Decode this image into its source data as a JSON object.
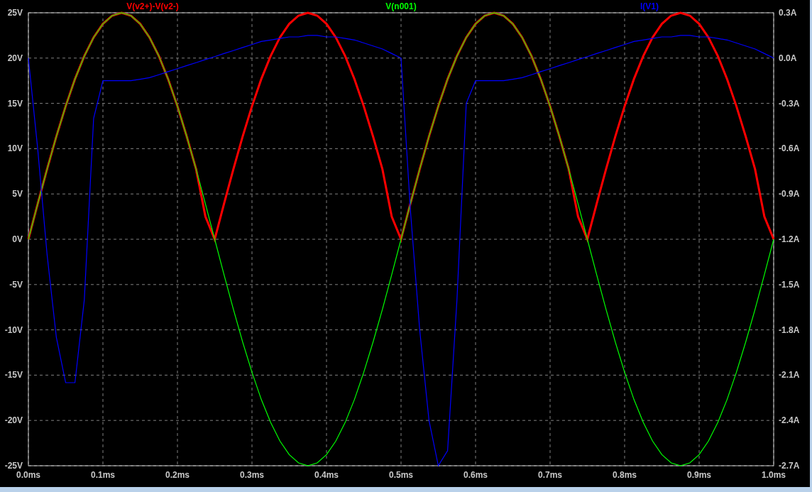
{
  "plot": {
    "chart_data": {
      "type": "line",
      "x": [
        0,
        0.0125,
        0.025,
        0.0375,
        0.05,
        0.0625,
        0.075,
        0.0875,
        0.1,
        0.1125,
        0.125,
        0.1375,
        0.15,
        0.1625,
        0.175,
        0.1875,
        0.2,
        0.2125,
        0.225,
        0.2375,
        0.25,
        0.2625,
        0.275,
        0.2875,
        0.3,
        0.3125,
        0.325,
        0.3375,
        0.35,
        0.3625,
        0.375,
        0.3875,
        0.4,
        0.4125,
        0.425,
        0.4375,
        0.45,
        0.4625,
        0.475,
        0.4875,
        0.5,
        0.5125,
        0.525,
        0.5375,
        0.55,
        0.5625,
        0.575,
        0.5875,
        0.6,
        0.6125,
        0.625,
        0.6375,
        0.65,
        0.6625,
        0.675,
        0.6875,
        0.7,
        0.7125,
        0.725,
        0.7375,
        0.75,
        0.7625,
        0.775,
        0.7875,
        0.8,
        0.8125,
        0.825,
        0.8375,
        0.85,
        0.8625,
        0.875,
        0.8875,
        0.9,
        0.9125,
        0.925,
        0.9375,
        0.95,
        0.9625,
        0.975,
        0.9875,
        1
      ],
      "series": [
        {
          "name": "V(v2+)-V(v2-)",
          "color": "#ff0000",
          "values": [
            0,
            3.91,
            7.73,
            11.35,
            14.69,
            17.68,
            20.23,
            22.28,
            23.78,
            24.69,
            25,
            24.69,
            23.78,
            22.28,
            20.23,
            17.68,
            14.69,
            11.35,
            7.73,
            2.5,
            0,
            3.91,
            7.73,
            11.35,
            14.69,
            17.68,
            20.23,
            22.28,
            23.78,
            24.69,
            25,
            24.69,
            23.78,
            22.28,
            20.23,
            17.68,
            14.69,
            11.35,
            7.73,
            2.5,
            0,
            3.91,
            7.73,
            11.35,
            14.69,
            17.68,
            20.23,
            22.28,
            23.78,
            24.69,
            25,
            24.69,
            23.78,
            22.28,
            20.23,
            17.68,
            14.69,
            11.35,
            7.73,
            2.5,
            0,
            3.91,
            7.73,
            11.35,
            14.69,
            17.68,
            20.23,
            22.28,
            23.78,
            24.69,
            25,
            24.69,
            23.78,
            22.28,
            20.23,
            17.68,
            14.69,
            11.35,
            7.73,
            2.5,
            0
          ]
        },
        {
          "name": "V(n001)",
          "color": "#00ff00",
          "values": [
            0,
            3.91,
            7.73,
            11.35,
            14.69,
            17.68,
            20.23,
            22.28,
            23.78,
            24.69,
            25,
            24.69,
            23.78,
            22.28,
            20.23,
            17.68,
            14.69,
            11.35,
            7.73,
            3.91,
            0,
            -3.91,
            -7.73,
            -11.35,
            -14.69,
            -17.68,
            -20.23,
            -22.28,
            -23.78,
            -24.69,
            -25,
            -24.69,
            -23.78,
            -22.28,
            -20.23,
            -17.68,
            -14.69,
            -11.35,
            -7.73,
            -3.91,
            0,
            3.91,
            7.73,
            11.35,
            14.69,
            17.68,
            20.23,
            22.28,
            23.78,
            24.69,
            25,
            24.69,
            23.78,
            22.28,
            20.23,
            17.68,
            14.69,
            11.35,
            7.73,
            3.91,
            0,
            -3.91,
            -7.73,
            -11.35,
            -14.69,
            -17.68,
            -20.23,
            -22.28,
            -23.78,
            -24.69,
            -25,
            -24.69,
            -23.78,
            -22.28,
            -20.23,
            -17.68,
            -14.69,
            -11.35,
            -7.73,
            -3.91,
            0
          ]
        },
        {
          "name": "I(V1)",
          "color": "#0000ff",
          "axis": "y2",
          "values": [
            0,
            -0.6,
            -1.3,
            -1.85,
            -2.15,
            -2.15,
            -1.6,
            -0.4,
            -0.15,
            -0.15,
            -0.15,
            -0.15,
            -0.14,
            -0.13,
            -0.11,
            -0.09,
            -0.07,
            -0.05,
            -0.03,
            -0.01,
            0.01,
            0.03,
            0.05,
            0.07,
            0.09,
            0.11,
            0.12,
            0.13,
            0.14,
            0.14,
            0.15,
            0.15,
            0.14,
            0.14,
            0.13,
            0.12,
            0.1,
            0.08,
            0.06,
            0.03,
            0,
            -1,
            -1.8,
            -2.4,
            -2.7,
            -2.6,
            -1.6,
            -0.3,
            -0.15,
            -0.15,
            -0.15,
            -0.15,
            -0.14,
            -0.13,
            -0.11,
            -0.09,
            -0.07,
            -0.05,
            -0.03,
            -0.01,
            0.01,
            0.03,
            0.05,
            0.07,
            0.09,
            0.11,
            0.12,
            0.13,
            0.14,
            0.14,
            0.15,
            0.15,
            0.14,
            0.14,
            0.13,
            0.12,
            0.1,
            0.08,
            0.06,
            0.03,
            0
          ]
        }
      ],
      "grid": true,
      "xlim": [
        0,
        1
      ],
      "ylim": [
        -25,
        25
      ],
      "y2lim": [
        -2.7,
        0.3
      ],
      "xticks": [
        {
          "value": 0,
          "label": "0.0ms"
        },
        {
          "value": 0.1,
          "label": "0.1ms"
        },
        {
          "value": 0.2,
          "label": "0.2ms"
        },
        {
          "value": 0.3,
          "label": "0.3ms"
        },
        {
          "value": 0.4,
          "label": "0.4ms"
        },
        {
          "value": 0.5,
          "label": "0.5ms"
        },
        {
          "value": 0.6,
          "label": "0.6ms"
        },
        {
          "value": 0.7,
          "label": "0.7ms"
        },
        {
          "value": 0.8,
          "label": "0.8ms"
        },
        {
          "value": 0.9,
          "label": "0.9ms"
        },
        {
          "value": 1,
          "label": "1.0ms"
        }
      ],
      "yticks": [
        {
          "value": 25,
          "label": "25V"
        },
        {
          "value": 20,
          "label": "20V"
        },
        {
          "value": 15,
          "label": "15V"
        },
        {
          "value": 10,
          "label": "10V"
        },
        {
          "value": 5,
          "label": "5V"
        },
        {
          "value": 0,
          "label": "0V"
        },
        {
          "value": -5,
          "label": "-5V"
        },
        {
          "value": -10,
          "label": "-10V"
        },
        {
          "value": -15,
          "label": "-15V"
        },
        {
          "value": -20,
          "label": "-20V"
        },
        {
          "value": -25,
          "label": "-25V"
        }
      ],
      "y2ticks": [
        {
          "value": 0.3,
          "label": "0.3A"
        },
        {
          "value": 0,
          "label": "0.0A"
        },
        {
          "value": -0.3,
          "label": "-0.3A"
        },
        {
          "value": -0.6,
          "label": "-0.6A"
        },
        {
          "value": -0.9,
          "label": "-0.9A"
        },
        {
          "value": -1.2,
          "label": "-1.2A"
        },
        {
          "value": -1.5,
          "label": "-1.5A"
        },
        {
          "value": -1.8,
          "label": "-1.8A"
        },
        {
          "value": -2.1,
          "label": "-2.1A"
        },
        {
          "value": -2.4,
          "label": "-2.4A"
        },
        {
          "value": -2.7,
          "label": "-2.7A"
        }
      ]
    }
  }
}
